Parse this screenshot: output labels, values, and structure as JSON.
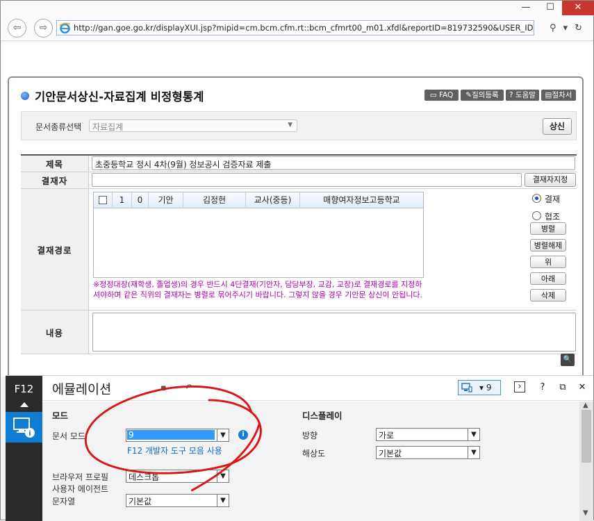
{
  "window": {
    "controls": {
      "minimize": "—",
      "maximize": "☐",
      "close": "✕"
    }
  },
  "browser": {
    "url": "http://gan.goe.go.kr/displayXUI.jsp?mipid=cm.bcm.cfm.rt::bcm_cfmrt00_m01.xfdl&reportID=819732590&USER_ID=superkjh&l",
    "search_icon": "⚲",
    "dropdown_icon": "▾",
    "refresh_icon": "↻"
  },
  "page": {
    "title": "기안문서상신-자료집계 비정형통계",
    "top_buttons": {
      "faq": "FAQ",
      "register": "질의등록",
      "help": "도움말",
      "procedure": "절차서"
    },
    "doc_type": {
      "label": "문서종류선택",
      "value": "자료집계"
    },
    "submit_label": "상신",
    "form": {
      "subject_label": "제목",
      "subject_value": "초중등학교 정시 4차(9월) 정보공시 검증자료 제출",
      "approver_label": "결재자",
      "approver_value": "",
      "approver_button": "결재자지정",
      "route_label": "결재경로",
      "route_row": {
        "col1": "1",
        "col2": "0",
        "type": "기안",
        "name": "김정현",
        "position": "교사(중등)",
        "org": "매향여자정보고등학교"
      },
      "warning": "※정정대장(재학생, 졸업생)의 경우 반드시 4단결재(기안자, 담당부장, 교감, 교장)로 결재경로를 지정하셔야하며 같은 직위의 결재자는 병렬로 묶어주시기 바랍니다. 그렇지 않을 경우 기안문 상신이 안됩니다.",
      "radio_approve": "결재",
      "radio_cooperate": "협조",
      "buttons": {
        "parallel": "병렬",
        "unparallel": "병렬해제",
        "up": "위",
        "down": "아래",
        "delete": "삭제"
      },
      "content_label": "내용"
    }
  },
  "devtools": {
    "f12_label": "F12",
    "title": "에뮬레이션",
    "doc_mode_badge": "9",
    "mode": {
      "section": "모드",
      "doc_mode_label": "문서 모드",
      "doc_mode_value": "9",
      "link": "F12 개발자 도구 모음 사용",
      "browser_profile_label": "브라우저 프로필",
      "browser_profile_value": "데스크톱",
      "user_agent_label": "사용자 에이전트",
      "string_label": "문자열",
      "string_value": "기본값"
    },
    "display": {
      "section": "디스플레이",
      "orientation_label": "방향",
      "orientation_value": "가로",
      "resolution_label": "해상도",
      "resolution_value": "기본값"
    },
    "header_buttons": {
      "console": "›",
      "help": "?",
      "undock": "⧉",
      "close": "✕"
    }
  },
  "colors": {
    "warning_text": "#b000b0",
    "accent_blue": "#0f7dd3",
    "close_red": "#c7372f",
    "annotation_red": "#d81818"
  }
}
